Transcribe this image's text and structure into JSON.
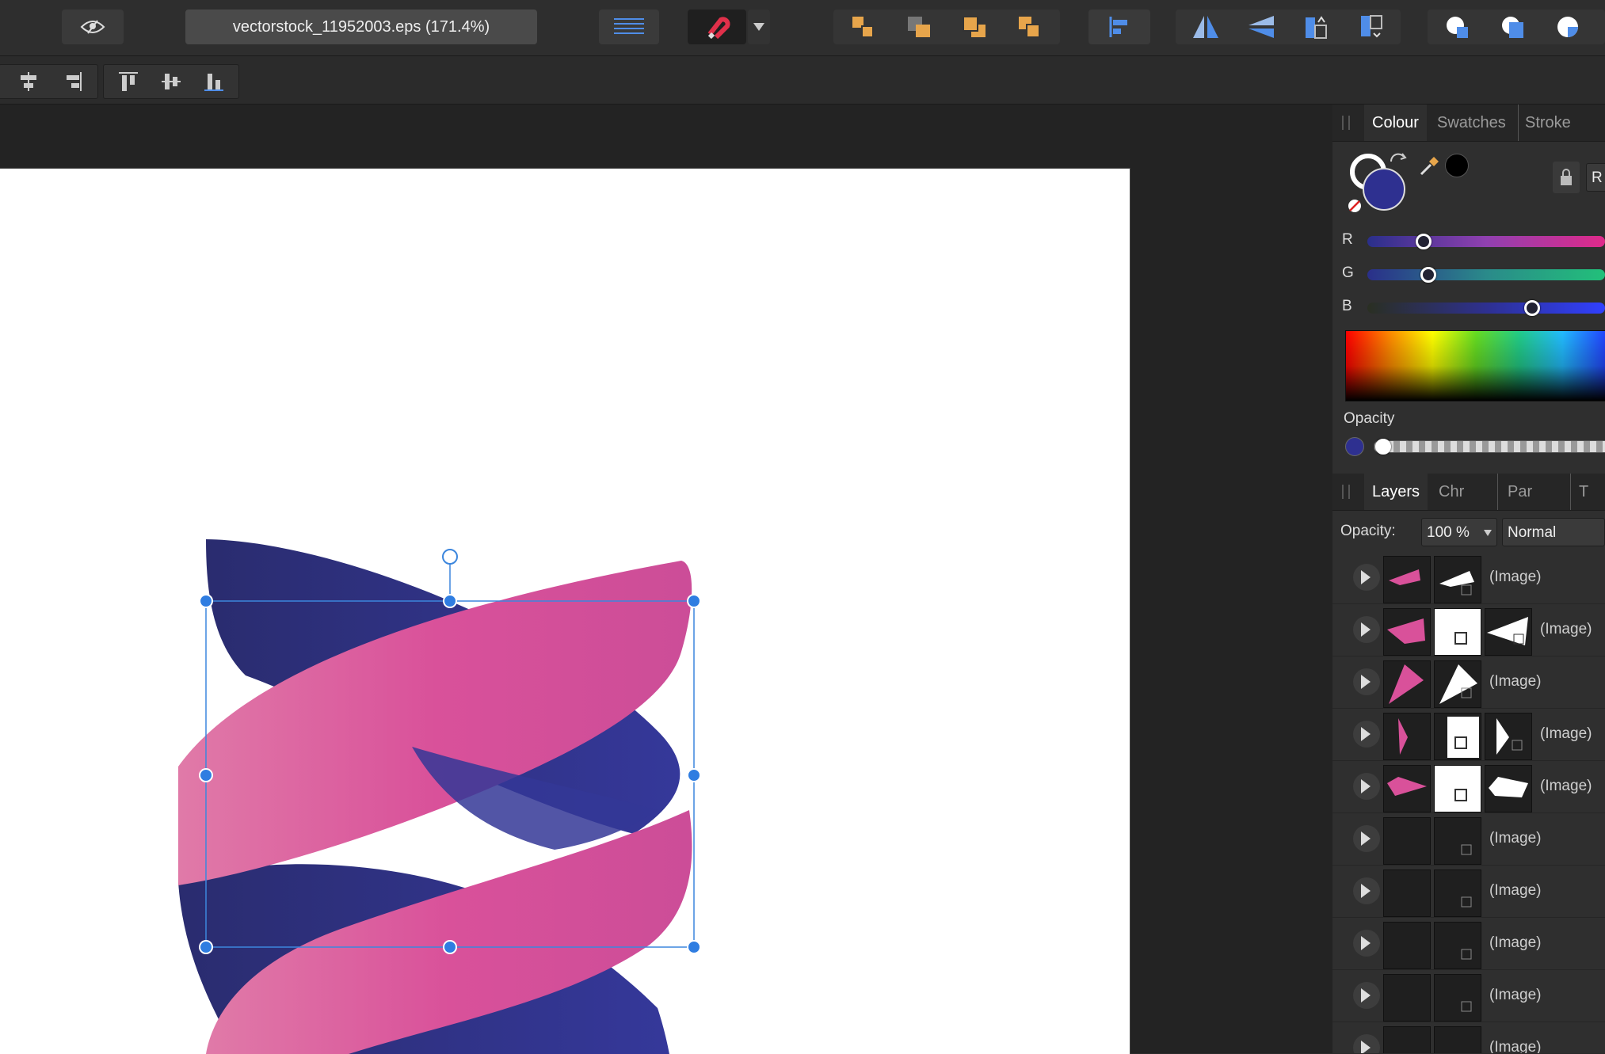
{
  "document": {
    "title": "vectorstock_11952003.eps (171.4%)"
  },
  "colour_panel": {
    "tabs": [
      "Colour",
      "Swatches",
      "Stroke"
    ],
    "channel_labels": [
      "R",
      "G",
      "B"
    ],
    "channel_values": {
      "R": 0.2,
      "G": 0.2,
      "B": 0.58
    },
    "opacity_label": "Opacity",
    "format_button": "R",
    "fill_color": "#2e3090",
    "stroke_color": "#ffffff"
  },
  "layers_panel": {
    "tabs": [
      "Layers",
      "Chr",
      "Par",
      "T"
    ],
    "opacity_label": "Opacity:",
    "opacity_value": "100 %",
    "blend_mode": "Normal",
    "rows": [
      {
        "name": "(Image)"
      },
      {
        "name": "(Image)"
      },
      {
        "name": "(Image)"
      },
      {
        "name": "(Image)"
      },
      {
        "name": "(Image)"
      },
      {
        "name": "(Image)"
      },
      {
        "name": "(Image)"
      },
      {
        "name": "(Image)"
      },
      {
        "name": "(Image)"
      },
      {
        "name": "(Image)"
      }
    ]
  },
  "colors": {
    "accent": "#2f7de1",
    "magenta": "#d9519a",
    "navy": "#2e3188",
    "orange": "#e7a54b"
  }
}
